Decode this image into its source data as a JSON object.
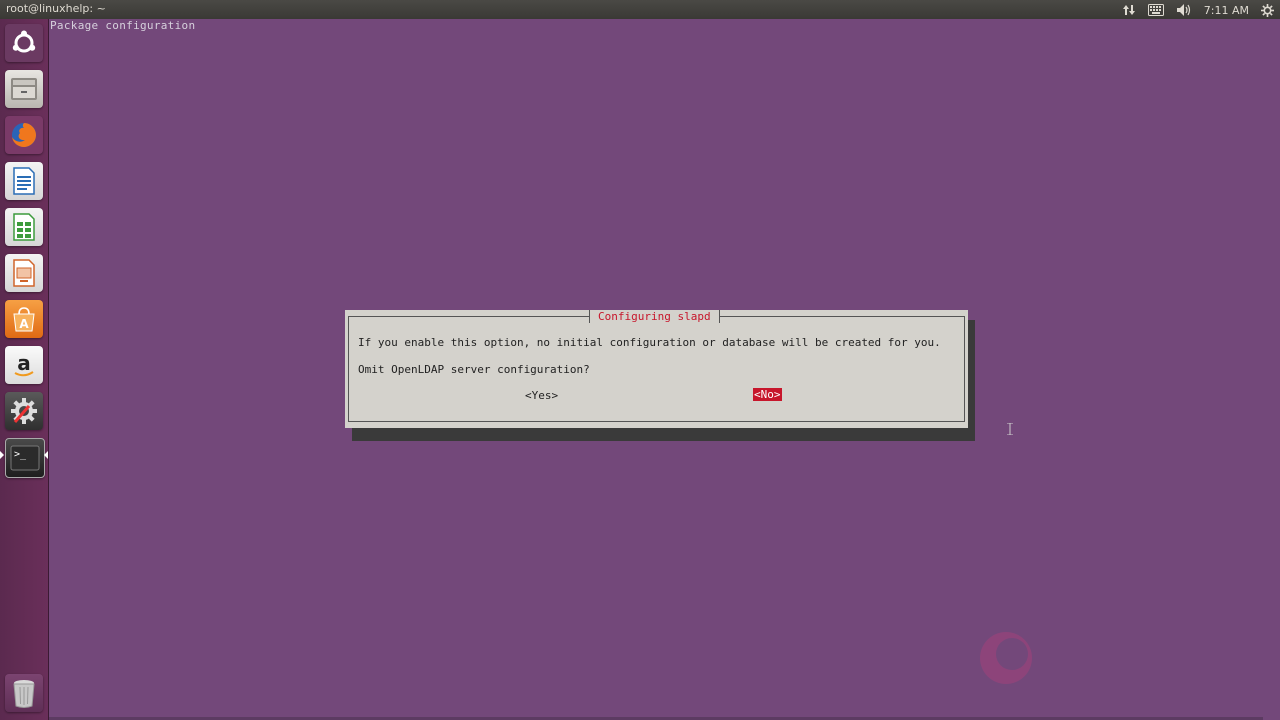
{
  "top_panel": {
    "window_title": "root@linuxhelp: ~",
    "clock": "7:11 AM"
  },
  "launcher": {
    "items": [
      {
        "name": "dash-home",
        "icon": "ubuntu-logo-icon"
      },
      {
        "name": "files",
        "icon": "file-manager-icon"
      },
      {
        "name": "firefox",
        "icon": "firefox-icon"
      },
      {
        "name": "writer",
        "icon": "writer-icon"
      },
      {
        "name": "calc",
        "icon": "calc-icon"
      },
      {
        "name": "impress",
        "icon": "impress-icon"
      },
      {
        "name": "software-center",
        "icon": "software-center-icon"
      },
      {
        "name": "amazon",
        "icon": "amazon-icon"
      },
      {
        "name": "system-settings",
        "icon": "settings-icon"
      },
      {
        "name": "terminal",
        "icon": "terminal-icon"
      },
      {
        "name": "trash",
        "icon": "trash-icon"
      }
    ],
    "amazon_glyph": "a",
    "terminal_glyph": ">_"
  },
  "terminal": {
    "header": "Package configuration"
  },
  "dialog": {
    "title": "Configuring slapd",
    "message": "If you enable this option, no initial configuration or database will be created for you.",
    "question": "Omit OpenLDAP server configuration?",
    "yes_label": "<Yes>",
    "no_label": "<No>",
    "selected": "no"
  },
  "colors": {
    "terminal_bg": "#73487a",
    "dialog_bg": "#d4d2cc",
    "accent_red": "#c7162b",
    "panel_bg": "#3c3b37"
  }
}
